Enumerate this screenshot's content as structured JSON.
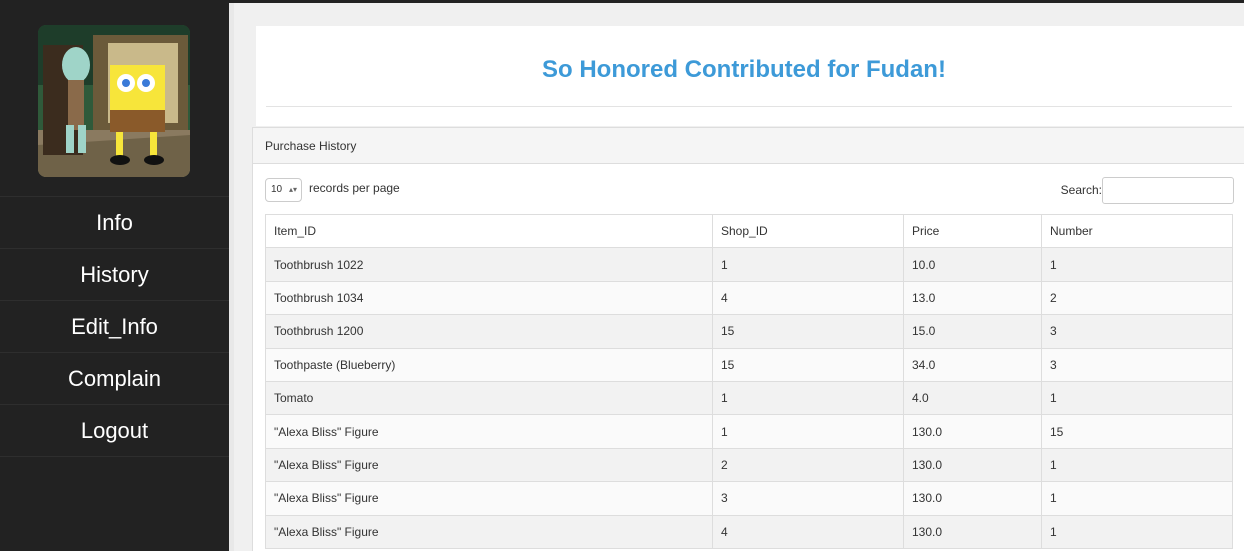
{
  "sidebar": {
    "avatar_alt": "SpongeBob and Squidward cartoon avatar",
    "items": [
      {
        "label": "Info"
      },
      {
        "label": "History"
      },
      {
        "label": "Edit_Info"
      },
      {
        "label": "Complain"
      },
      {
        "label": "Logout"
      }
    ]
  },
  "jumbotron": {
    "title": "So Honored Contributed for Fudan!"
  },
  "panel": {
    "heading": "Purchase History",
    "length_value": "10",
    "length_label": "records per page",
    "search_label": "Search:",
    "search_value": "",
    "columns": [
      "Item_ID",
      "Shop_ID",
      "Price",
      "Number"
    ],
    "rows": [
      [
        "Toothbrush 1022",
        "1",
        "10.0",
        "1"
      ],
      [
        "Toothbrush 1034",
        "4",
        "13.0",
        "2"
      ],
      [
        "Toothbrush 1200",
        "15",
        "15.0",
        "3"
      ],
      [
        "Toothpaste (Blueberry)",
        "15",
        "34.0",
        "3"
      ],
      [
        "Tomato",
        "1",
        "4.0",
        "1"
      ],
      [
        "\"Alexa Bliss\" Figure",
        "1",
        "130.0",
        "15"
      ],
      [
        "\"Alexa Bliss\" Figure",
        "2",
        "130.0",
        "1"
      ],
      [
        "\"Alexa Bliss\" Figure",
        "3",
        "130.0",
        "1"
      ],
      [
        "\"Alexa Bliss\" Figure",
        "4",
        "130.0",
        "1"
      ]
    ]
  },
  "colors": {
    "sidebar_bg": "#222222",
    "title_blue": "#3d9ad8",
    "page_bg": "#f0f0f0"
  }
}
